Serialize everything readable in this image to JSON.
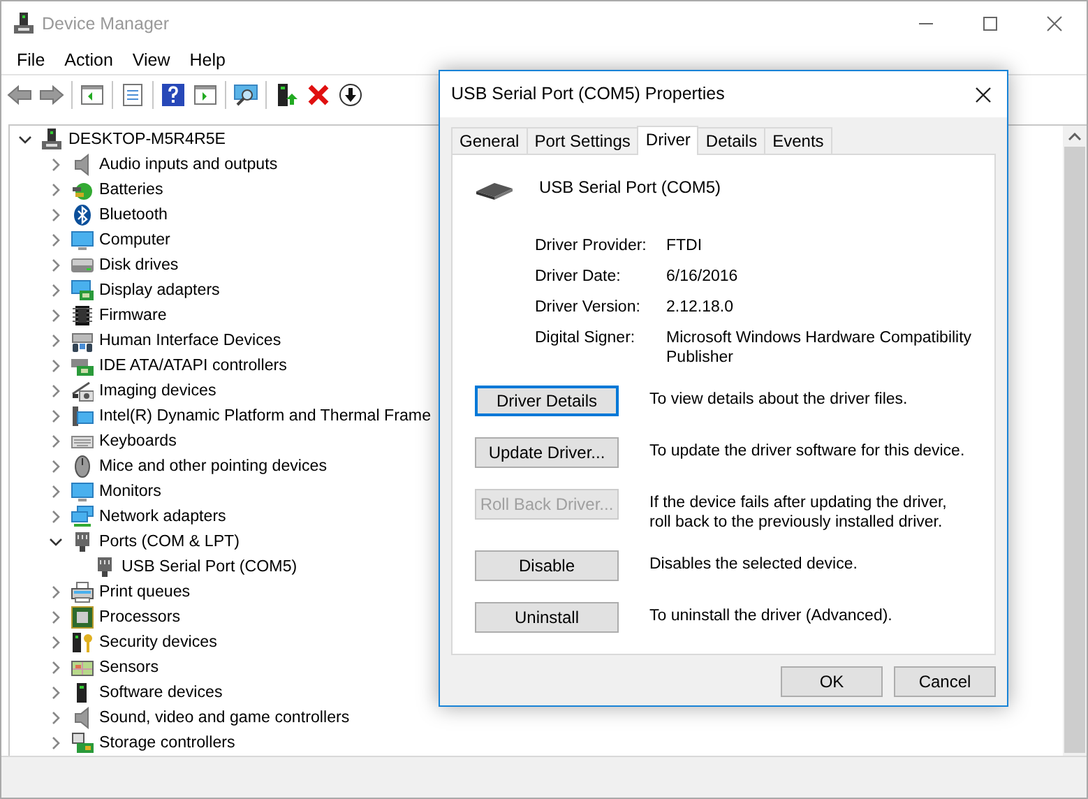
{
  "window": {
    "title": "Device Manager"
  },
  "menu": [
    "File",
    "Action",
    "View",
    "Help"
  ],
  "tree": {
    "label": "DESKTOP-M5R4R5E",
    "expanded": true,
    "children": [
      {
        "label": "Audio inputs and outputs",
        "expanded": false
      },
      {
        "label": "Batteries",
        "expanded": false
      },
      {
        "label": "Bluetooth",
        "expanded": false
      },
      {
        "label": "Computer",
        "expanded": false
      },
      {
        "label": "Disk drives",
        "expanded": false
      },
      {
        "label": "Display adapters",
        "expanded": false
      },
      {
        "label": "Firmware",
        "expanded": false
      },
      {
        "label": "Human Interface Devices",
        "expanded": false
      },
      {
        "label": "IDE ATA/ATAPI controllers",
        "expanded": false
      },
      {
        "label": "Imaging devices",
        "expanded": false
      },
      {
        "label": "Intel(R) Dynamic Platform and Thermal Frame",
        "expanded": false
      },
      {
        "label": "Keyboards",
        "expanded": false
      },
      {
        "label": "Mice and other pointing devices",
        "expanded": false
      },
      {
        "label": "Monitors",
        "expanded": false
      },
      {
        "label": "Network adapters",
        "expanded": false
      },
      {
        "label": "Ports (COM & LPT)",
        "expanded": true,
        "children": [
          {
            "label": "USB Serial Port (COM5)"
          }
        ]
      },
      {
        "label": "Print queues",
        "expanded": false
      },
      {
        "label": "Processors",
        "expanded": false
      },
      {
        "label": "Security devices",
        "expanded": false
      },
      {
        "label": "Sensors",
        "expanded": false
      },
      {
        "label": "Software devices",
        "expanded": false
      },
      {
        "label": "Sound, video and game controllers",
        "expanded": false
      },
      {
        "label": "Storage controllers",
        "expanded": false
      }
    ]
  },
  "dialog": {
    "title": "USB Serial Port (COM5) Properties",
    "tabs": [
      {
        "label": "General",
        "selected": false
      },
      {
        "label": "Port Settings",
        "selected": false
      },
      {
        "label": "Driver",
        "selected": true
      },
      {
        "label": "Details",
        "selected": false
      },
      {
        "label": "Events",
        "selected": false
      }
    ],
    "device_name": "USB Serial Port (COM5)",
    "fields": [
      {
        "label": "Driver Provider:",
        "value": "FTDI"
      },
      {
        "label": "Driver Date:",
        "value": "6/16/2016"
      },
      {
        "label": "Driver Version:",
        "value": "2.12.18.0"
      },
      {
        "label": "Digital Signer:",
        "value": "Microsoft Windows Hardware Compatibility Publisher"
      }
    ],
    "actions": [
      {
        "button": "Driver Details",
        "description": "To view details about the driver files.",
        "disabled": false,
        "focused": true
      },
      {
        "button": "Update Driver...",
        "description": "To update the driver software for this device.",
        "disabled": false,
        "focused": false
      },
      {
        "button": "Roll Back Driver...",
        "description": "If the device fails after updating the driver, roll back to the previously installed driver.",
        "disabled": true,
        "focused": false
      },
      {
        "button": "Disable",
        "description": "Disables the selected device.",
        "disabled": false,
        "focused": false
      },
      {
        "button": "Uninstall",
        "description": "To uninstall the driver (Advanced).",
        "disabled": false,
        "focused": false
      }
    ],
    "buttons": [
      "OK",
      "Cancel"
    ]
  }
}
